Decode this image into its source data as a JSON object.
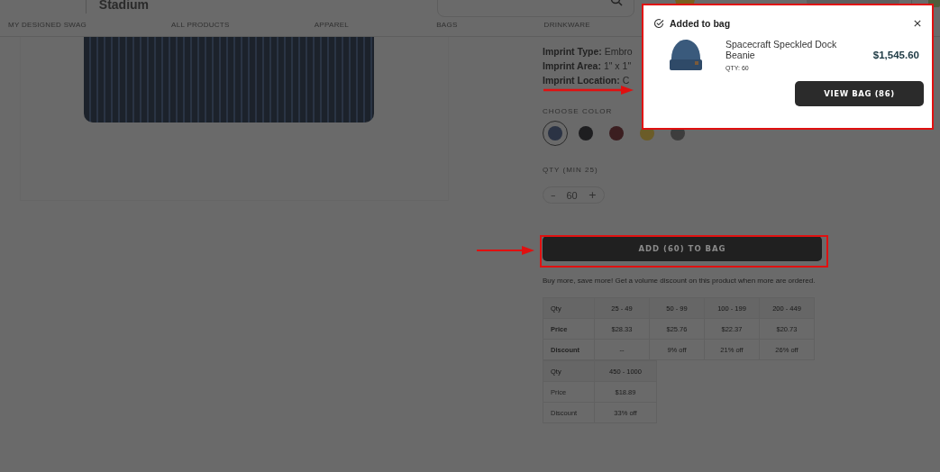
{
  "header": {
    "logo": "Stadium"
  },
  "nav": [
    {
      "label": "MY DESIGNED SWAG"
    },
    {
      "label": "ALL PRODUCTS"
    },
    {
      "label": "APPAREL"
    },
    {
      "label": "BAGS"
    },
    {
      "label": "DRINKWARE"
    }
  ],
  "product": {
    "imprint": [
      "**Imprint Type:** Embro",
      "**Imprint Area:** 1\" x 1\"",
      "**Imprint Location:** C"
    ],
    "color_label": "CHOOSE COLOR",
    "colors": [
      {
        "color": "#2b3344",
        "selected": true
      },
      {
        "color": "#1e1e20",
        "selected": false
      },
      {
        "color": "#3b1e20",
        "selected": false
      },
      {
        "color": "#6b5c28",
        "selected": false
      },
      {
        "color": "#3d3d3d",
        "selected": false
      }
    ],
    "qty_label": "QTY (MIN 25)",
    "qty_minus": "–",
    "qty": "60",
    "qty_plus": "+",
    "add_button": "ADD (60) TO BAG",
    "note": "Buy more, save more! Get a volume discount on this product when more are ordered.",
    "pricing_tables": [
      {
        "rows": [
          [
            "Qty",
            "25 - 49",
            "50 - 99",
            "100 - 199",
            "200 - 449"
          ],
          [
            "Price",
            "$28.33",
            "$25.76",
            "$22.37",
            "$20.73"
          ],
          [
            "Discount",
            "--",
            "9% off",
            "21% off",
            "26% off"
          ]
        ]
      },
      {
        "rows": [
          [
            "Qty",
            "450 - 1000"
          ],
          [
            "Price",
            "$18.89"
          ],
          [
            "Discount",
            "33% off"
          ]
        ]
      }
    ]
  },
  "popup": {
    "title": "Added to bag",
    "item_name": "Spacecraft Speckled Dock Beanie",
    "item_qty": "QTY: 60",
    "item_price": "$1,545.60",
    "button": "VIEW BAG (86)"
  }
}
